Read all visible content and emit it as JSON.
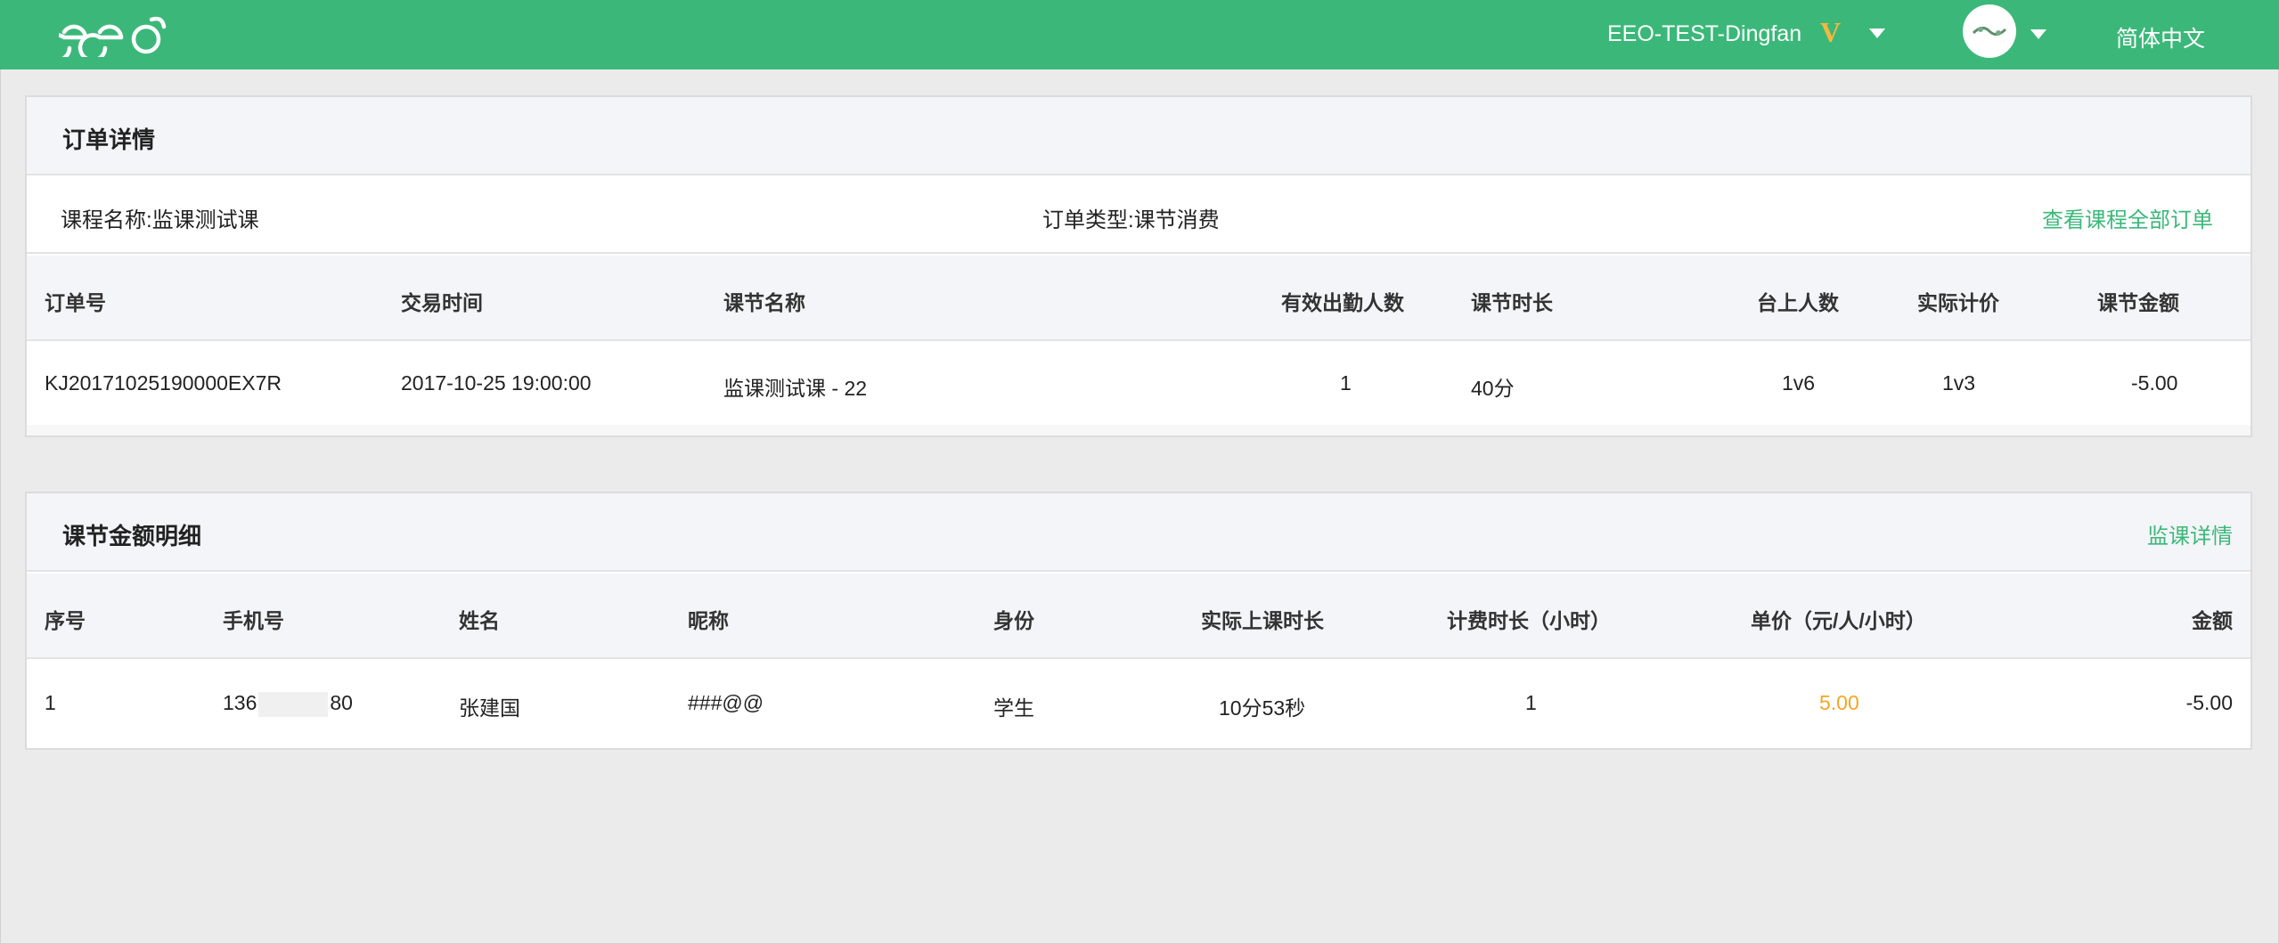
{
  "header": {
    "user_name": "EEO-TEST-Dingfan",
    "vip_badge": "V",
    "language": "简体中文",
    "brand_color": "#3bb879"
  },
  "order_panel": {
    "title": "订单详情",
    "course_label": "课程名称:",
    "course_name": "监课测试课",
    "order_type_label": "订单类型:",
    "order_type": "课节消费",
    "view_all_link": "查看课程全部订单",
    "columns": [
      "订单号",
      "交易时间",
      "课节名称",
      "有效出勤人数",
      "课节时长",
      "台上人数",
      "实际计价",
      "课节金额"
    ],
    "rows": [
      {
        "order_no": "KJ20171025190000EX7R",
        "time": "2017-10-25 19:00:00",
        "lesson_name": "监课测试课 - 22",
        "attendance": "1",
        "duration": "40分",
        "on_stage": "1v6",
        "billing": "1v3",
        "amount": "-5.00"
      }
    ]
  },
  "detail_panel": {
    "title": "课节金额明细",
    "monitor_link": "监课详情",
    "columns": [
      "序号",
      "手机号",
      "姓名",
      "昵称",
      "身份",
      "实际上课时长",
      "计费时长（小时）",
      "单价（元/人/小时）",
      "金额"
    ],
    "rows": [
      {
        "index": "1",
        "phone_prefix": "136",
        "phone_suffix": "80",
        "name": "张建国",
        "nickname": "###@@",
        "role": "学生",
        "actual_duration": "10分53秒",
        "billing_hours": "1",
        "unit_price": "5.00",
        "amount": "-5.00"
      }
    ]
  }
}
